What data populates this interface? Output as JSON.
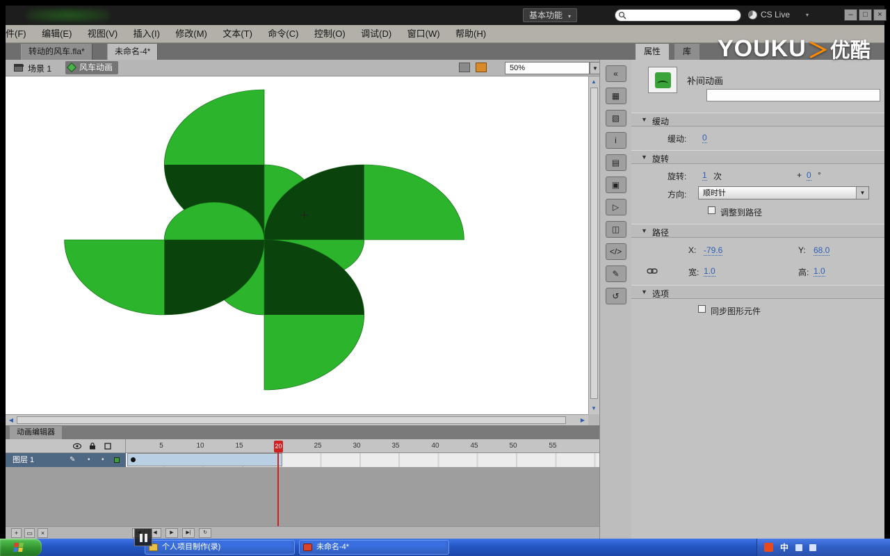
{
  "window": {
    "workspace": "基本功能",
    "cs_live": "CS Live",
    "search_value": "",
    "controls": {
      "minimize": "–",
      "maximize": "□",
      "close": "×"
    }
  },
  "menubar": {
    "items": [
      "文件(F)",
      "编辑(E)",
      "视图(V)",
      "插入(I)",
      "修改(M)",
      "文本(T)",
      "命令(C)",
      "控制(O)",
      "调试(D)",
      "窗口(W)",
      "帮助(H)"
    ]
  },
  "doc_tabs": [
    {
      "label": "转动的风车.fla*"
    },
    {
      "label": "未命名-4*"
    }
  ],
  "editbar": {
    "scene": "场景 1",
    "symbol": "风车动画",
    "zoom": "50%"
  },
  "watermark": {
    "brand": "YOUKU",
    "chevron": "＞",
    "suffix": "优酷"
  },
  "dock": {
    "icons": [
      {
        "name": "collapse-dock-icon",
        "glyph": "«"
      },
      {
        "name": "align-panel-icon",
        "glyph": "▦"
      },
      {
        "name": "color-panel-icon",
        "glyph": "▧"
      },
      {
        "name": "info-panel-icon",
        "glyph": "i"
      },
      {
        "name": "swatches-panel-icon",
        "glyph": "▤"
      },
      {
        "name": "transform-panel-icon",
        "glyph": "▣"
      },
      {
        "name": "motion-presets-panel-icon",
        "glyph": "▷"
      },
      {
        "name": "components-panel-icon",
        "glyph": "◫"
      },
      {
        "name": "code-snippets-panel-icon",
        "glyph": "</>"
      },
      {
        "name": "strings-panel-icon",
        "glyph": "✎"
      },
      {
        "name": "history-panel-icon",
        "glyph": "↺"
      }
    ]
  },
  "properties": {
    "tabs": {
      "properties": "属性",
      "library": "库"
    },
    "tween_type": "补间动画",
    "instance_value": "",
    "ease": {
      "section": "缓动",
      "label": "缓动:",
      "value": "0"
    },
    "rotation": {
      "section": "旋转",
      "label": "旋转:",
      "count": "1",
      "unit": "次",
      "plus": "+",
      "degrees": "0",
      "deg_unit": "°",
      "direction_label": "方向:",
      "direction": "顺时针",
      "orient_label": "调整到路径"
    },
    "path": {
      "section": "路径",
      "x_label": "X:",
      "x": "-79.6",
      "y_label": "Y:",
      "y": "68.0",
      "w_label": "宽:",
      "w": "1.0",
      "h_label": "高:",
      "h": "1.0"
    },
    "options": {
      "section": "选项",
      "sync_label": "同步图形元件"
    }
  },
  "timeline": {
    "tab": "动画编辑器",
    "frames": [
      "5",
      "10",
      "15",
      "20",
      "25",
      "30",
      "35",
      "40",
      "45",
      "50",
      "55"
    ],
    "playhead_frame": "20",
    "layer": {
      "name": "图层 1"
    },
    "controls": [
      {
        "name": "go-first-frame-button",
        "glyph": "|◀"
      },
      {
        "name": "step-back-button",
        "glyph": "◀"
      },
      {
        "name": "play-button",
        "glyph": "▶"
      },
      {
        "name": "step-forward-button",
        "glyph": "▶|"
      },
      {
        "name": "loop-button",
        "glyph": "↻"
      }
    ],
    "layer_buttons": [
      {
        "name": "new-layer-button",
        "glyph": "+"
      },
      {
        "name": "new-folder-button",
        "glyph": "▭"
      },
      {
        "name": "delete-layer-button",
        "glyph": "×"
      }
    ]
  },
  "stage": {
    "background": "#ffffff",
    "pinwheel_light": "#2cb42c",
    "pinwheel_dark": "#0b430d"
  },
  "taskbar": {
    "tasks": [
      {
        "label": "个人项目制作(录)"
      },
      {
        "label": "未命名-4*"
      }
    ],
    "tray_ime": "中"
  },
  "icons": {
    "caret": "▼",
    "caret_small": "▾",
    "up": "▲",
    "down": "▼",
    "left": "◀",
    "right": "▶",
    "bullet": "•",
    "pencil": "✎"
  }
}
